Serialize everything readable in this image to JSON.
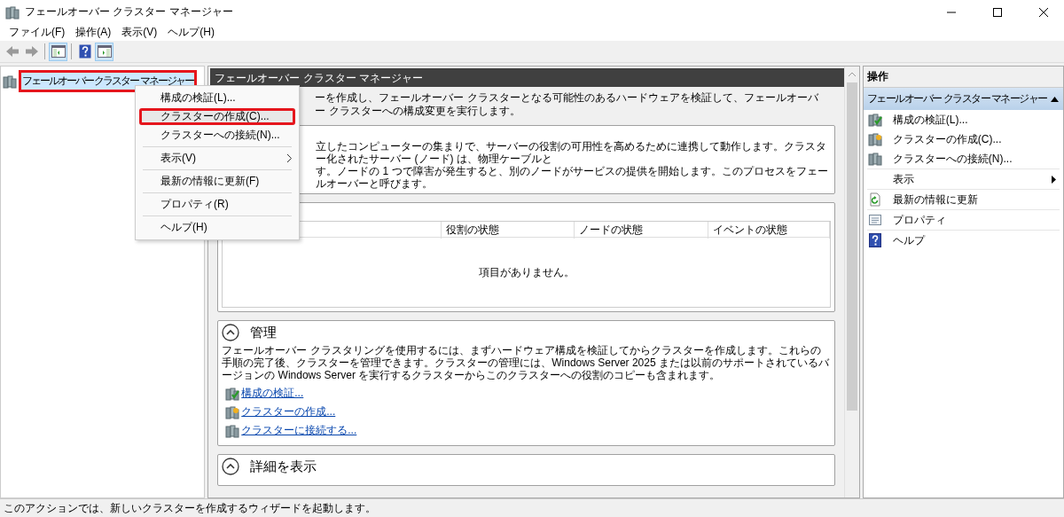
{
  "window": {
    "title": "フェールオーバー クラスター マネージャー"
  },
  "menu_bar": [
    "ファイル(F)",
    "操作(A)",
    "表示(V)",
    "ヘルプ(H)"
  ],
  "toolbar": [
    {
      "kind": "back",
      "disabled": true
    },
    {
      "kind": "forward",
      "disabled": true
    },
    {
      "kind": "console-tree",
      "pressed": true
    },
    {
      "kind": "help",
      "pressed": false
    },
    {
      "kind": "action-pane",
      "pressed": true
    }
  ],
  "tree": {
    "items": [
      {
        "label": "フェールオーバー クラスター マネージャー",
        "selected": true,
        "highlighted": true
      }
    ]
  },
  "context_menu": {
    "items": [
      {
        "kind": "item",
        "label": "構成の検証(L)...",
        "selected": false,
        "highlighted": false
      },
      {
        "kind": "item",
        "label": "クラスターの作成(C)...",
        "selected": true,
        "highlighted": true
      },
      {
        "kind": "item",
        "label": "クラスターへの接続(N)...",
        "selected": false,
        "highlighted": false
      },
      {
        "kind": "separator"
      },
      {
        "kind": "submenu",
        "label": "表示(V)",
        "selected": false,
        "highlighted": false
      },
      {
        "kind": "separator"
      },
      {
        "kind": "item",
        "label": "最新の情報に更新(F)",
        "selected": false,
        "highlighted": false
      },
      {
        "kind": "separator"
      },
      {
        "kind": "item",
        "label": "プロパティ(R)",
        "selected": false,
        "highlighted": false
      },
      {
        "kind": "separator"
      },
      {
        "kind": "item",
        "label": "ヘルプ(H)",
        "selected": false,
        "highlighted": false
      }
    ]
  },
  "center": {
    "header": "フェールオーバー クラスター マネージャー",
    "intro": "ーを作成し、フェールオーバー クラスターとなる可能性のあるハードウェアを検証して、フェールオーバー クラスターへの構成変更を実行します。",
    "sections": [
      {
        "kind": "text",
        "lines": [
          "立したコンピューターの集まりで、サーバーの役割の可用性を高めるために連携して動作します。クラスター化されたサーバー (ノード) は、物理ケーブルと",
          "す。ノードの 1 つで障害が発生すると、別のノードがサービスの提供を開始します。このプロセスをフェールオーバーと呼びます。"
        ]
      },
      {
        "kind": "table",
        "columns": [
          "役割の状態",
          "ノードの状態",
          "イベントの状態"
        ],
        "empty_text": "項目がありません。"
      },
      {
        "kind": "links",
        "title": "管理",
        "expanded": true,
        "text": "フェールオーバー クラスタリングを使用するには、まずハードウェア構成を検証してからクラスターを作成します。これらの手順の完了後、クラスターを管理できます。クラスターの管理には、Windows Server 2025 または以前のサポートされているバージョンの Windows Server を実行するクラスターからこのクラスターへの役割のコピーも含まれます。",
        "links": [
          {
            "kind": "validate",
            "label": "構成の検証..."
          },
          {
            "kind": "create",
            "label": "クラスターの作成..."
          },
          {
            "kind": "connect",
            "label": "クラスターに接続する..."
          }
        ]
      },
      {
        "kind": "links",
        "title": "詳細を表示",
        "expanded": true
      }
    ]
  },
  "actions": {
    "title": "操作",
    "group": {
      "title": "フェールオーバー クラスター マネージャー",
      "expanded": true
    },
    "items": [
      {
        "kind": "validate",
        "label": "構成の検証(L)..."
      },
      {
        "kind": "create",
        "label": "クラスターの作成(C)..."
      },
      {
        "kind": "connect",
        "label": "クラスターへの接続(N)..."
      },
      {
        "kind": "submenu",
        "label": "表示"
      },
      {
        "kind": "refresh",
        "label": "最新の情報に更新"
      },
      {
        "kind": "properties",
        "label": "プロパティ"
      },
      {
        "kind": "help",
        "label": "ヘルプ"
      }
    ]
  },
  "status_bar": "このアクションでは、新しいクラスターを作成するウィザードを起動します。"
}
